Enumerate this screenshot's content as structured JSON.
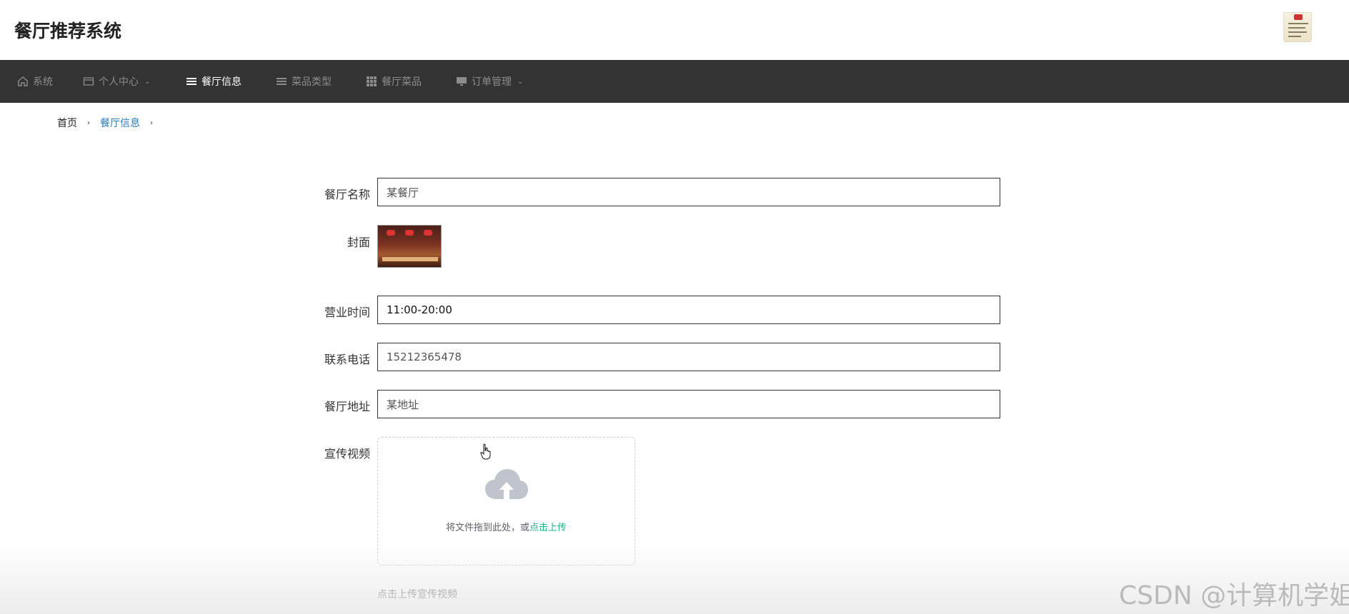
{
  "app": {
    "title": "餐厅推荐系统"
  },
  "nav": {
    "items": [
      {
        "label": "系统",
        "icon": "home-icon",
        "active": false,
        "dropdown": false
      },
      {
        "label": "个人中心",
        "icon": "wallet-icon",
        "active": false,
        "dropdown": true
      },
      {
        "label": "餐厅信息",
        "icon": "list-icon",
        "active": true,
        "dropdown": false
      },
      {
        "label": "菜品类型",
        "icon": "list-icon",
        "active": false,
        "dropdown": false
      },
      {
        "label": "餐厅菜品",
        "icon": "grid-icon",
        "active": false,
        "dropdown": false
      },
      {
        "label": "订单管理",
        "icon": "monitor-icon",
        "active": false,
        "dropdown": true
      }
    ],
    "caret": "⌄"
  },
  "breadcrumb": {
    "home": "首页",
    "current": "餐厅信息",
    "separator": "›"
  },
  "form": {
    "name": {
      "label": "餐厅名称",
      "value": "某餐厅"
    },
    "cover": {
      "label": "封面"
    },
    "hours": {
      "label": "营业时间",
      "value": "11:00-20:00"
    },
    "phone": {
      "label": "联系电话",
      "value": "15212365478"
    },
    "address": {
      "label": "餐厅地址",
      "value": "某地址"
    },
    "video": {
      "label": "宣传视频",
      "drop_text": "将文件拖到此处，或",
      "link_text": "点击上传",
      "tip": "点击上传宣传视频"
    }
  },
  "watermark": "CSDN @计算机学姐",
  "colors": {
    "navbar_bg": "#333333",
    "nav_active": "#ffffff",
    "nav_inactive": "#8c8c8c",
    "breadcrumb_active": "#2a7bb8",
    "upload_link": "#19b38a"
  }
}
